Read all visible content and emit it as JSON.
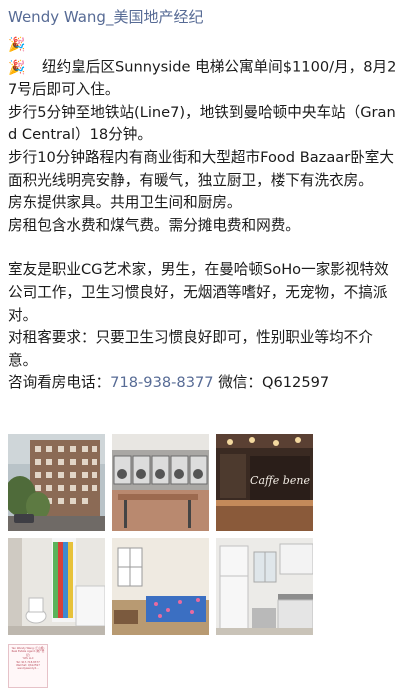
{
  "author": "Wendy Wang_美国地产经纪",
  "post": {
    "lines": [
      "纽约皇后区Sunnyside 电梯公寓单间$1100/月，8月27号后即可入住。",
      "步行5分钟至地铁站(Line7)，地铁到曼哈顿中央车站（Grand Central）18分钟。",
      "步行10分钟路程内有商业街和大型超市Food Bazaar卧室大面积光线明亮安静，有暖气，独立厨卫，楼下有洗衣房。",
      "房东提供家具。共用卫生间和厨房。",
      "房租包含水费和煤气费。需分摊电费和网费。"
    ],
    "roommate_lines": [
      "室友是职业CG艺术家，男生，在曼哈顿SoHo一家影视特效公司工作，卫生习惯良好，无烟酒等嗜好，无宠物，不搞派对。",
      "对租客要求：只要卫生习惯良好即可，性别职业等均不介意。"
    ],
    "contact_prefix": "咨询看房电话：",
    "phone": "718-938-8377",
    "wechat_label": " 微信：",
    "wechat_id": "Q612597"
  },
  "photos": [
    {
      "icon": "apartment-building-photo"
    },
    {
      "icon": "laundry-room-photo"
    },
    {
      "icon": "caffe-bene-cafe-photo"
    },
    {
      "icon": "bathroom-photo"
    },
    {
      "icon": "bedroom-photo"
    },
    {
      "icon": "kitchen-photo"
    }
  ],
  "cafe_sign": "Caffe bene",
  "card": {
    "lines": [
      "Yan Wendy Wang (王小姐)",
      "Real Estate Agent (地产经纪)",
      "YWL LLC",
      "Tel: 917-718-8377",
      "WeChat: Q612597",
      "wendywendy2..."
    ]
  },
  "colors": {
    "link": "#576b95",
    "text": "#1a1a1a"
  }
}
